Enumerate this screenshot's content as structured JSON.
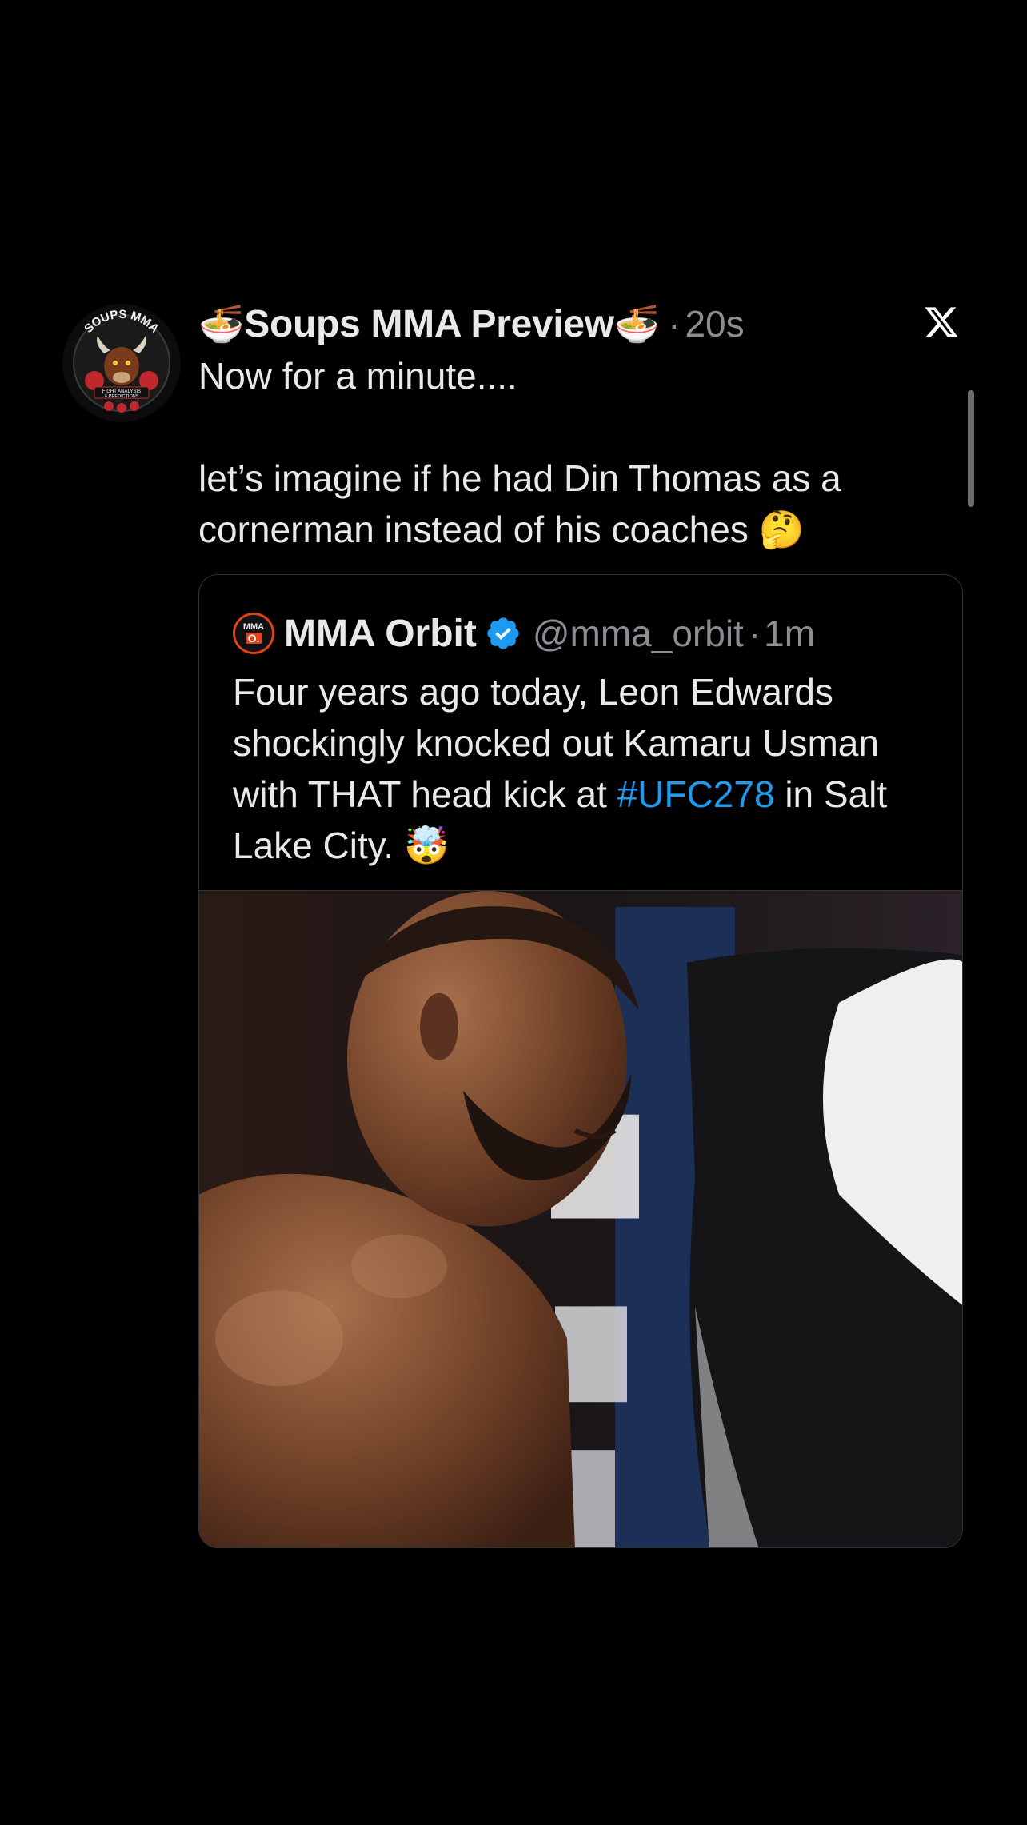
{
  "post": {
    "bowl_emoji": "🍜",
    "display_name": "Soups MMA Preview",
    "separator": "·",
    "time": "20s",
    "text_line1": "Now for a minute....",
    "text_line2": "let’s imagine if he had Din Thomas as a cornerman instead of his coaches",
    "text_emoji": "🤔",
    "avatar_text_top": "SOUPS MMA",
    "avatar_text_bottom1": "FIGHT ANALYSIS",
    "avatar_text_bottom2": "& PREDICTIONS"
  },
  "quote": {
    "logo_top": "MMA",
    "logo_bottom": "O.",
    "name": "MMA Orbit",
    "handle": "@mma_orbit",
    "separator": "·",
    "time": "1m",
    "text_before": "Four years ago today, Leon Edwards shockingly knocked out Kamaru Usman with THAT head kick at",
    "hashtag": "#UFC278",
    "text_after": "in Salt Lake City.",
    "text_emoji": "🤯"
  },
  "colors": {
    "background": "#000000",
    "text": "#e7e9ea",
    "muted": "#8b8f94",
    "link": "#1d9bf0",
    "verified": "#1d9bf0",
    "border": "#2f3336"
  },
  "icons": {
    "close": "x-logo-close-icon",
    "verified": "verified-badge-icon"
  }
}
